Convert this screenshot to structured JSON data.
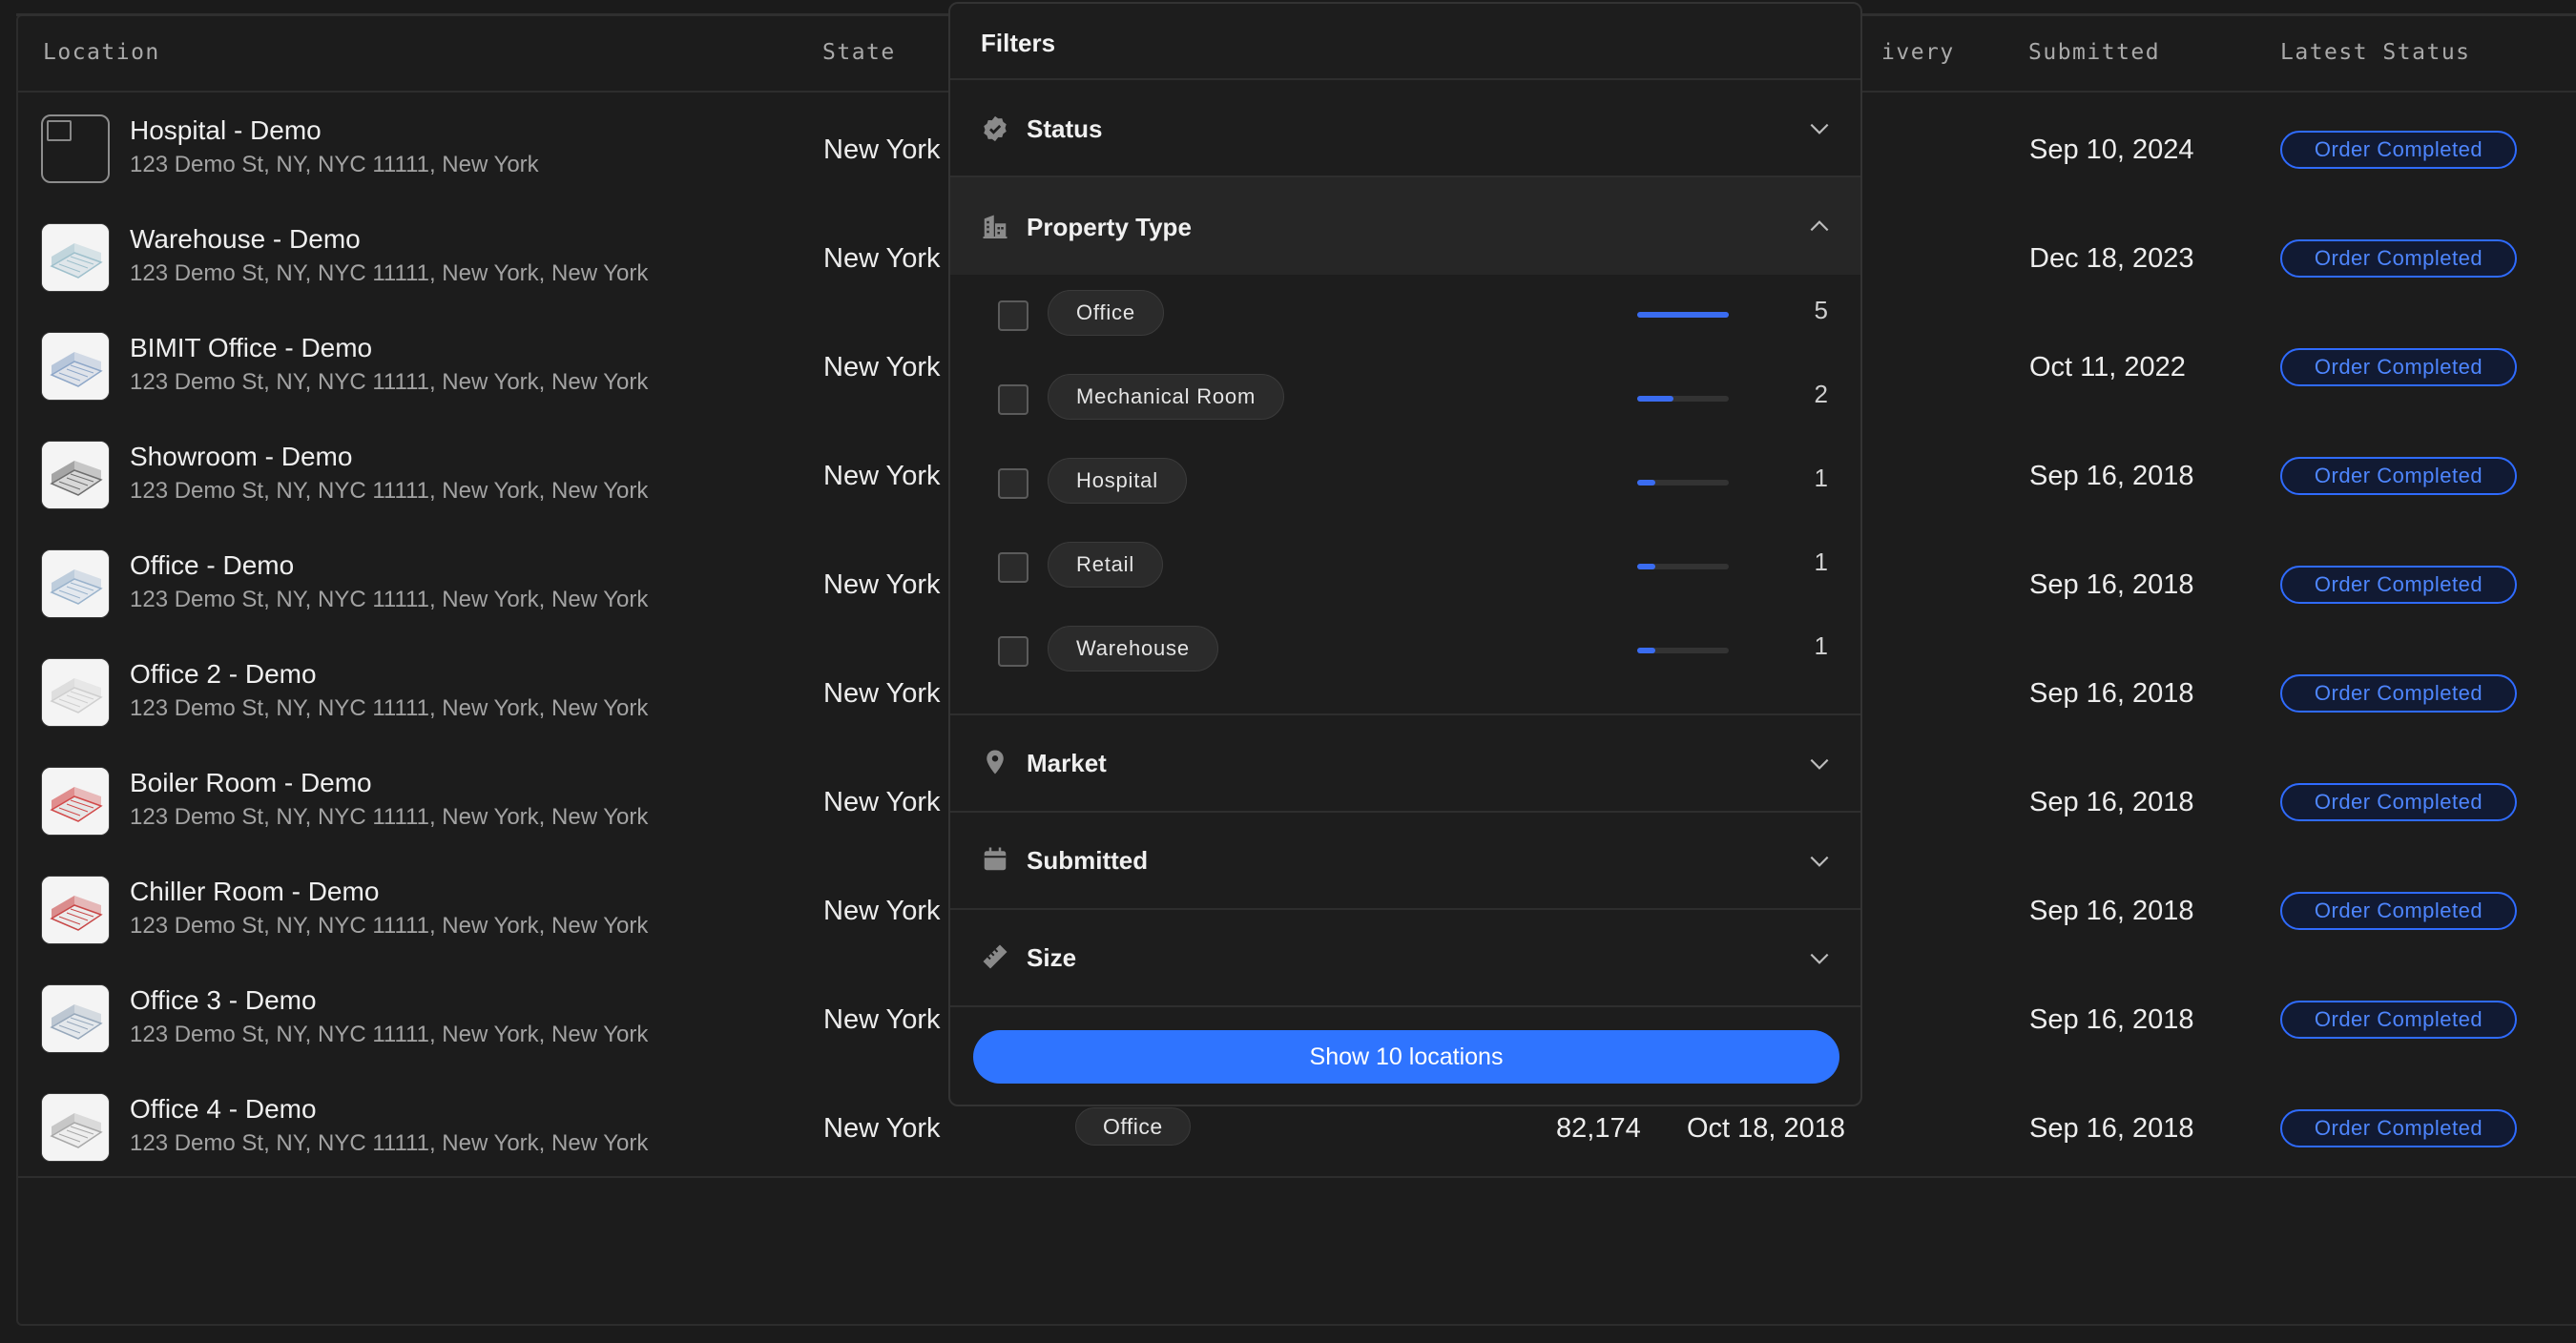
{
  "table": {
    "headers": {
      "location": "Location",
      "state": "State",
      "delivery_partial": "ivery",
      "submitted": "Submitted",
      "latest_status": "Latest Status"
    },
    "rows": [
      {
        "name": "Hospital - Demo",
        "address": "123 Demo St, NY, NYC 11111, New York",
        "state": "New York",
        "submitted": "Sep 10, 2024",
        "status": "Order Completed"
      },
      {
        "name": "Warehouse - Demo",
        "address": "123 Demo St, NY, NYC 11111, New York, New York",
        "state": "New York",
        "submitted": "Dec 18, 2023",
        "status": "Order Completed"
      },
      {
        "name": "BIMIT Office - Demo",
        "address": "123 Demo St, NY, NYC 11111, New York, New York",
        "state": "New York",
        "submitted": "Oct 11, 2022",
        "status": "Order Completed"
      },
      {
        "name": "Showroom - Demo",
        "address": "123 Demo St, NY, NYC 11111, New York, New York",
        "state": "New York",
        "submitted": "Sep 16, 2018",
        "status": "Order Completed"
      },
      {
        "name": "Office - Demo",
        "address": "123 Demo St, NY, NYC 11111, New York, New York",
        "state": "New York",
        "submitted": "Sep 16, 2018",
        "status": "Order Completed"
      },
      {
        "name": "Office 2 - Demo",
        "address": "123 Demo St, NY, NYC 11111, New York, New York",
        "state": "New York",
        "submitted": "Sep 16, 2018",
        "status": "Order Completed"
      },
      {
        "name": "Boiler Room - Demo",
        "address": "123 Demo St, NY, NYC 11111, New York, New York",
        "state": "New York",
        "submitted": "Sep 16, 2018",
        "status": "Order Completed"
      },
      {
        "name": "Chiller Room - Demo",
        "address": "123 Demo St, NY, NYC 11111, New York, New York",
        "state": "New York",
        "submitted": "Sep 16, 2018",
        "status": "Order Completed"
      },
      {
        "name": "Office 3 - Demo",
        "address": "123 Demo St, NY, NYC 11111, New York, New York",
        "state": "New York",
        "submitted": "Sep 16, 2018",
        "status": "Order Completed"
      },
      {
        "name": "Office 4 - Demo",
        "address": "123 Demo St, NY, NYC 11111, New York, New York",
        "state": "New York",
        "submitted": "Sep 16, 2018",
        "status": "Order Completed",
        "property_type": "Office",
        "size": "82,174",
        "delivery": "Oct 18, 2018"
      }
    ]
  },
  "filters": {
    "title": "Filters",
    "sections": {
      "status": {
        "label": "Status",
        "icon": "verified-badge-icon"
      },
      "property_type": {
        "label": "Property Type",
        "icon": "building-icon",
        "options": [
          {
            "label": "Office",
            "count": "5",
            "share": 1.0
          },
          {
            "label": "Mechanical Room",
            "count": "2",
            "share": 0.4
          },
          {
            "label": "Hospital",
            "count": "1",
            "share": 0.2
          },
          {
            "label": "Retail",
            "count": "1",
            "share": 0.2
          },
          {
            "label": "Warehouse",
            "count": "1",
            "share": 0.2
          }
        ]
      },
      "market": {
        "label": "Market",
        "icon": "map-pin-icon"
      },
      "submitted": {
        "label": "Submitted",
        "icon": "calendar-icon"
      },
      "size": {
        "label": "Size",
        "icon": "ruler-icon"
      }
    },
    "show_button": "Show 10 locations"
  },
  "colors": {
    "accent": "#2f74ff",
    "status_badge": "#4e86ff",
    "background": "#1b1b1b"
  }
}
